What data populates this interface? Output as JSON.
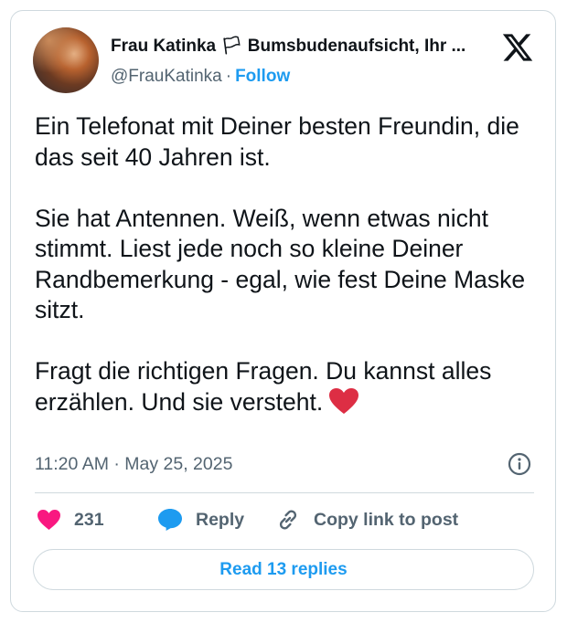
{
  "author": {
    "display_name": "Frau Katinka 🏳 Bumsbudenaufsicht, Ihr ...",
    "handle": "@FrauKatinka",
    "separator": "·",
    "follow_label": "Follow"
  },
  "tweet": {
    "paragraphs": [
      "Ein Telefonat mit Deiner besten Freundin, die das seit 40 Jahren ist.",
      "Sie hat Antennen. Weiß, wenn etwas nicht stimmt. Liest jede noch so kleine Deiner Randbemerkung - egal, wie fest Deine Maske sitzt.",
      "Fragt die richtigen Fragen. Du kannst alles erzählen. Und sie versteht."
    ],
    "trailing_emoji": "red-heart-emoji",
    "timestamp": "11:20 AM · May 25, 2025"
  },
  "actions": {
    "like_count": "231",
    "reply_label": "Reply",
    "copy_link_label": "Copy link to post"
  },
  "read_replies_label": "Read 13 replies",
  "colors": {
    "accent": "#1d9bf0",
    "like": "#f91880",
    "text": "#0f1419",
    "muted": "#536471",
    "border": "#cfd9de"
  }
}
